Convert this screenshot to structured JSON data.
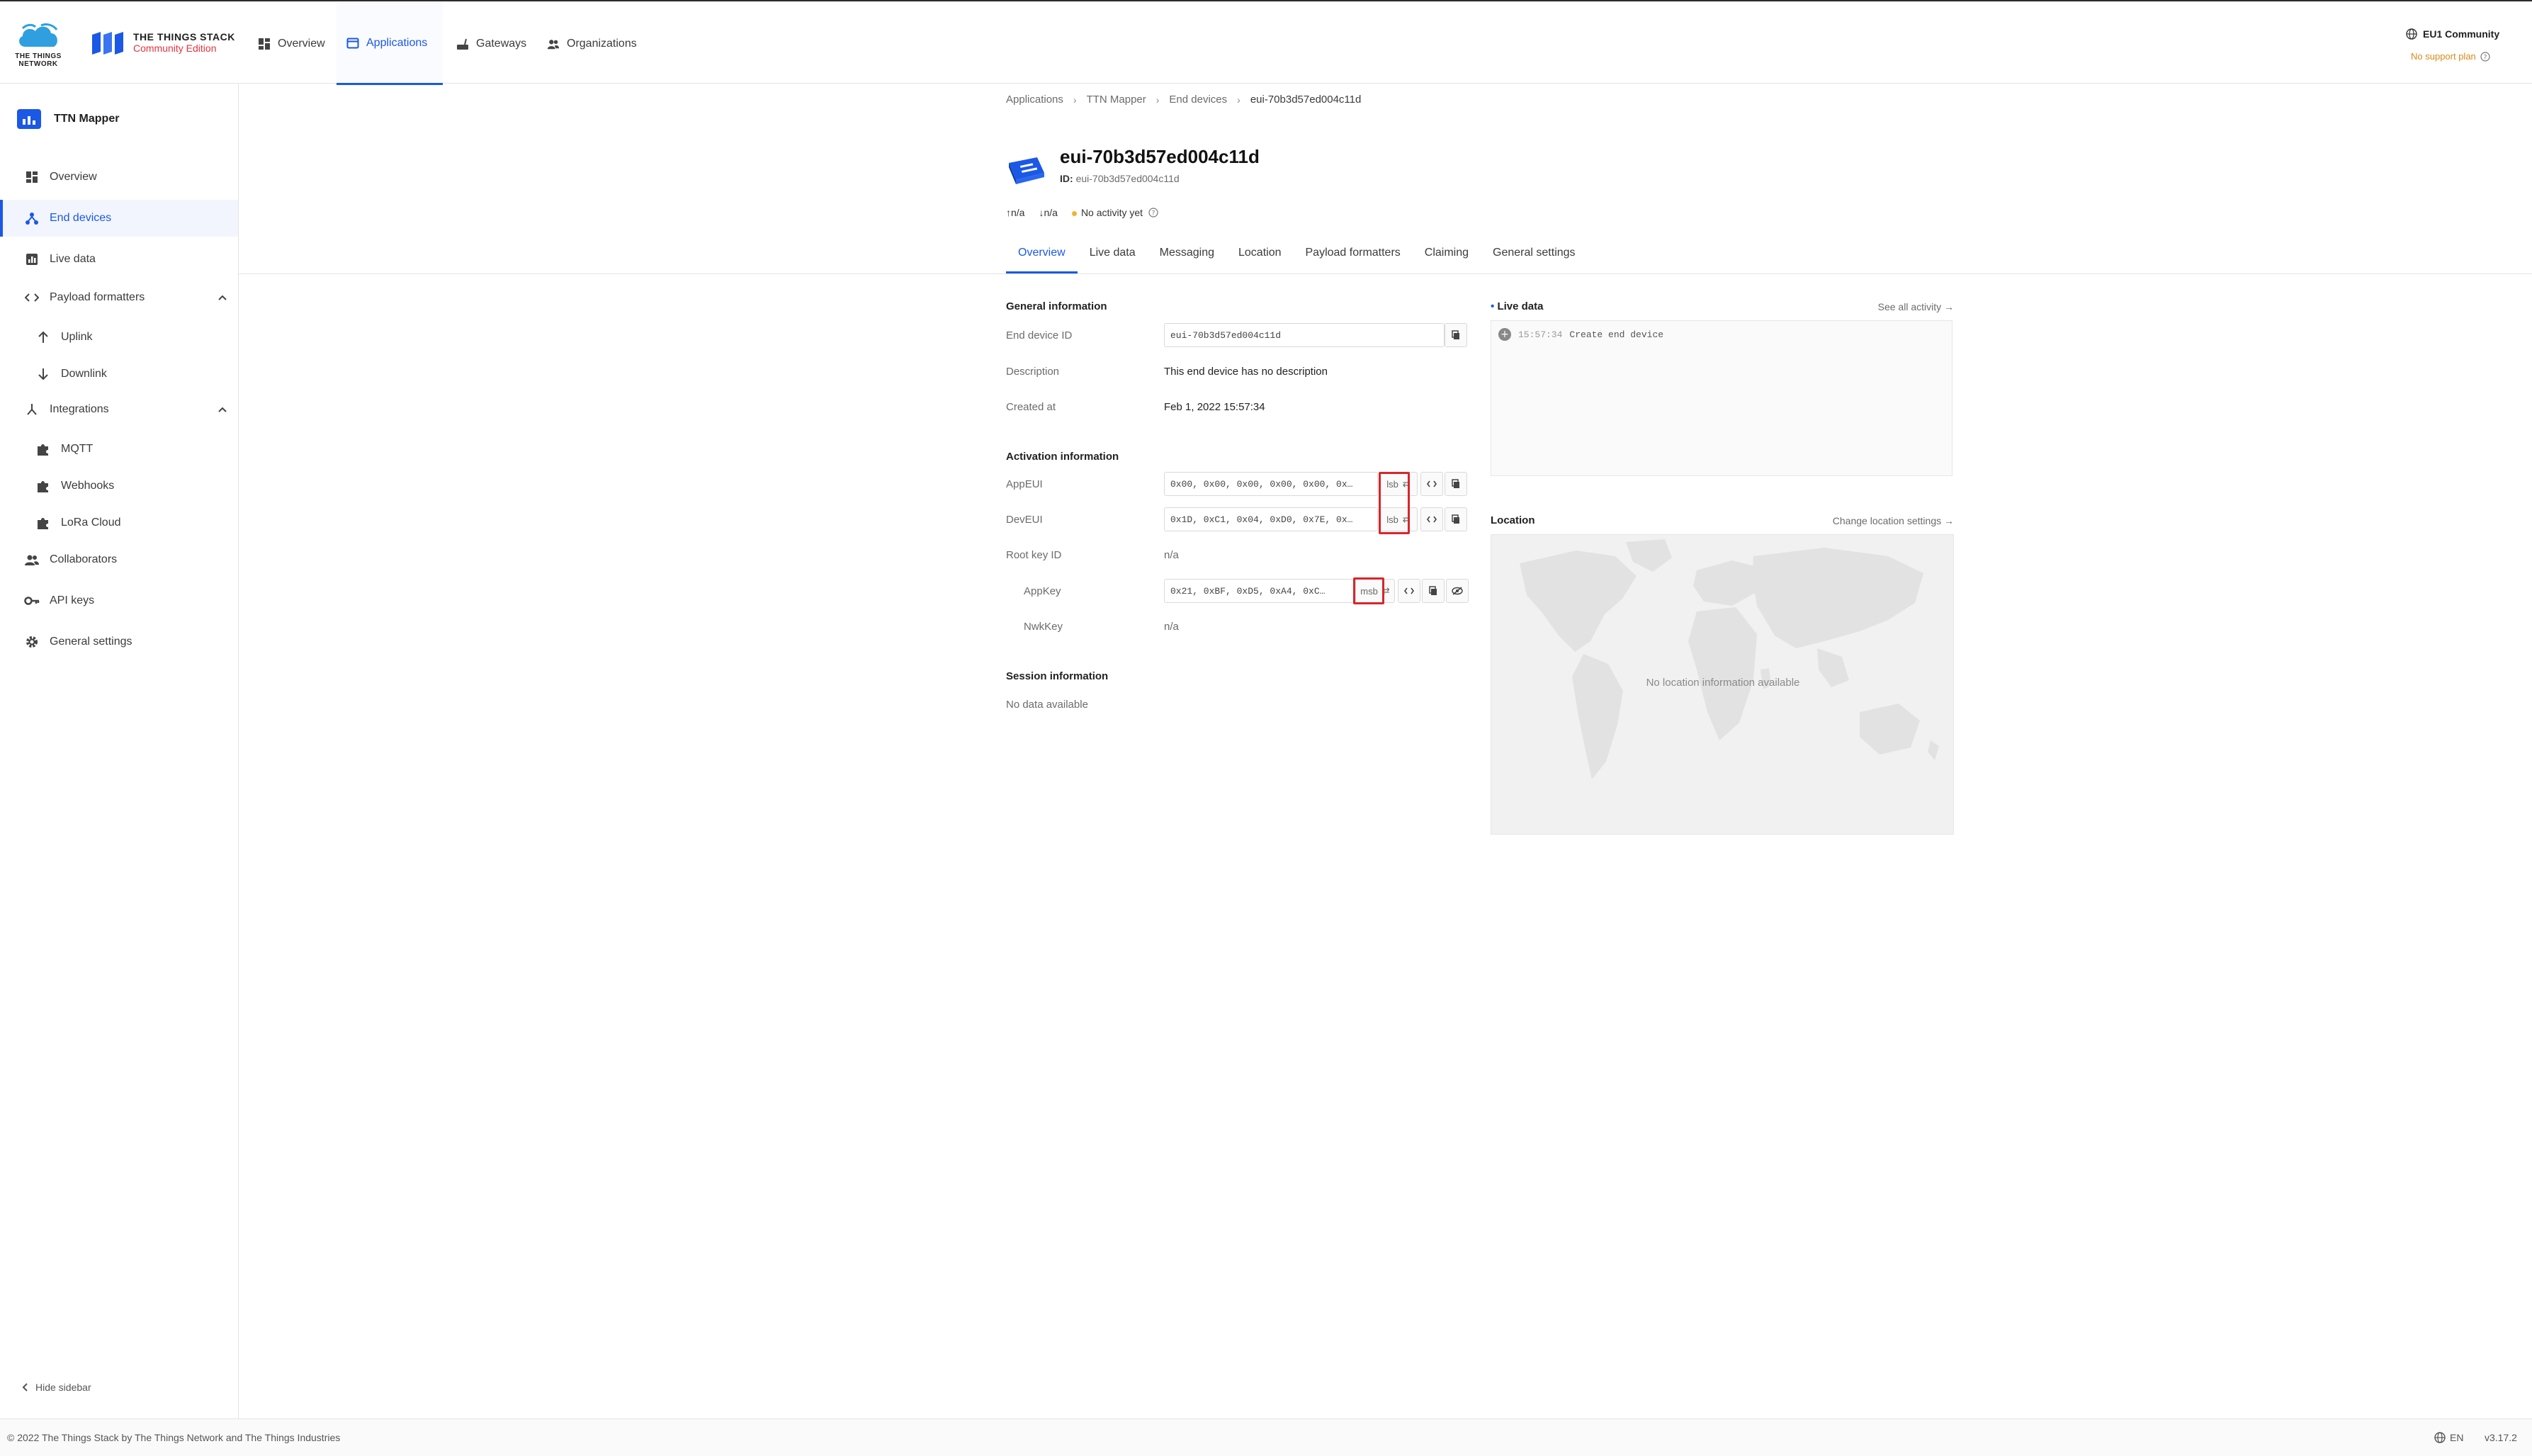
{
  "header": {
    "logo_text": "THE THINGS NETWORK",
    "product_line1": "THE THINGS STACK",
    "product_line2": "Community Edition",
    "nav": [
      {
        "label": "Overview",
        "icon": "grid-icon"
      },
      {
        "label": "Applications",
        "icon": "application-icon",
        "active": true
      },
      {
        "label": "Gateways",
        "icon": "gateway-icon"
      },
      {
        "label": "Organizations",
        "icon": "organizations-icon"
      }
    ],
    "cluster": "EU1 Community",
    "support": "No support plan"
  },
  "sidebar": {
    "app_title": "TTN Mapper",
    "items": [
      {
        "label": "Overview",
        "icon": "grid-icon"
      },
      {
        "label": "End devices",
        "icon": "devices-icon",
        "active": true
      },
      {
        "label": "Live data",
        "icon": "chart-icon"
      },
      {
        "label": "Payload formatters",
        "icon": "code-icon"
      },
      {
        "label": "Uplink",
        "icon": "arrow-up-icon"
      },
      {
        "label": "Downlink",
        "icon": "arrow-down-icon"
      },
      {
        "label": "Integrations",
        "icon": "integrations-icon"
      },
      {
        "label": "MQTT",
        "icon": "puzzle-icon"
      },
      {
        "label": "Webhooks",
        "icon": "puzzle-icon"
      },
      {
        "label": "LoRa Cloud",
        "icon": "puzzle-icon"
      },
      {
        "label": "Collaborators",
        "icon": "people-icon"
      },
      {
        "label": "API keys",
        "icon": "key-icon"
      },
      {
        "label": "General settings",
        "icon": "gear-icon"
      }
    ],
    "hide_label": "Hide sidebar"
  },
  "breadcrumb": [
    "Applications",
    "TTN Mapper",
    "End devices",
    "eui-70b3d57ed004c11d"
  ],
  "device": {
    "title": "eui-70b3d57ed004c11d",
    "id_label": "ID:",
    "id_value": "eui-70b3d57ed004c11d",
    "uplink": "n/a",
    "downlink": "n/a",
    "activity": "No activity yet"
  },
  "tabs": [
    "Overview",
    "Live data",
    "Messaging",
    "Location",
    "Payload formatters",
    "Claiming",
    "General settings"
  ],
  "general": {
    "title": "General information",
    "end_device_id_label": "End device ID",
    "end_device_id": "eui-70b3d57ed004c11d",
    "description_label": "Description",
    "description": "This end device has no description",
    "created_label": "Created at",
    "created": "Feb 1, 2022 15:57:34"
  },
  "activation": {
    "title": "Activation information",
    "appeui_label": "AppEUI",
    "appeui": "0x00, 0x00, 0x00, 0x00, 0x00, 0x…",
    "appeui_order": "lsb",
    "deveui_label": "DevEUI",
    "deveui": "0x1D, 0xC1, 0x04, 0xD0, 0x7E, 0x…",
    "deveui_order": "lsb",
    "root_key_label": "Root key ID",
    "root_key": "n/a",
    "appkey_label": "AppKey",
    "appkey": "0x21, 0xBF, 0xD5, 0xA4, 0xC…",
    "appkey_order": "msb",
    "nwkkey_label": "NwkKey",
    "nwkkey": "n/a"
  },
  "session": {
    "title": "Session information",
    "value": "No data available"
  },
  "live": {
    "title": "Live data",
    "link": "See all activity →",
    "entry_time": "15:57:34",
    "entry_text": "Create end device"
  },
  "location": {
    "title": "Location",
    "link": "Change location settings →",
    "empty": "No location information available"
  },
  "footer": {
    "copyright": "© 2022 The Things Stack by The Things Network and The Things Industries",
    "lang": "EN",
    "version": "v3.17.2"
  }
}
